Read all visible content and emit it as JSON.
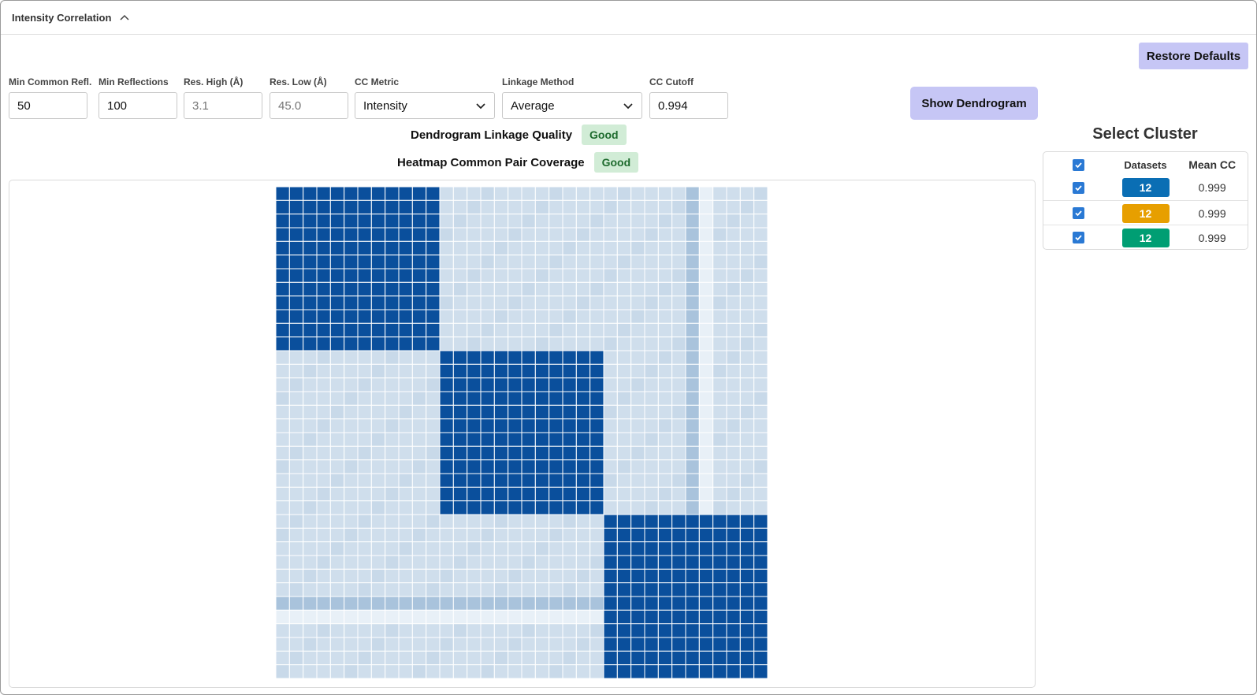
{
  "header": {
    "title": "Intensity Correlation"
  },
  "restore_label": "Restore Defaults",
  "fields": {
    "min_common_refl": {
      "label": "Min Common Refl.",
      "value": "50"
    },
    "min_reflections": {
      "label": "Min Reflections",
      "value": "100"
    },
    "res_high": {
      "label": "Res. High (Å)",
      "placeholder": "3.1"
    },
    "res_low": {
      "label": "Res. Low (Å)",
      "placeholder": "45.0"
    },
    "cc_metric": {
      "label": "CC Metric",
      "value": "Intensity"
    },
    "linkage_method": {
      "label": "Linkage Method",
      "value": "Average"
    },
    "cc_cutoff": {
      "label": "CC Cutoff",
      "value": "0.994"
    }
  },
  "show_dendrogram_label": "Show Dendrogram",
  "quality": {
    "dendrogram_label": "Dendrogram Linkage Quality",
    "dendrogram_status": "Good",
    "heatmap_label": "Heatmap Common Pair Coverage",
    "heatmap_status": "Good"
  },
  "cluster": {
    "title": "Select Cluster",
    "col_datasets": "Datasets",
    "col_mean_cc": "Mean CC",
    "rows": [
      {
        "datasets": "12",
        "mean_cc": "0.999",
        "color": "#0a6eb4"
      },
      {
        "datasets": "12",
        "mean_cc": "0.999",
        "color": "#e79f00"
      },
      {
        "datasets": "12",
        "mean_cc": "0.999",
        "color": "#009e73"
      }
    ]
  },
  "colors": {
    "in_cluster": "#0a4f9c",
    "off_cluster": "#cfdeec",
    "off_cluster_alt": "#c8d9e9",
    "weak": "#a9c3dc",
    "faint": "#e8f0f7",
    "accent": "#c6c6f5"
  },
  "chart_data": {
    "type": "heatmap",
    "size": 36,
    "clusters": [
      {
        "start": 0,
        "end": 11
      },
      {
        "start": 12,
        "end": 23
      },
      {
        "start": 24,
        "end": 35
      }
    ],
    "weak_index": 30,
    "faint_index": 31
  }
}
